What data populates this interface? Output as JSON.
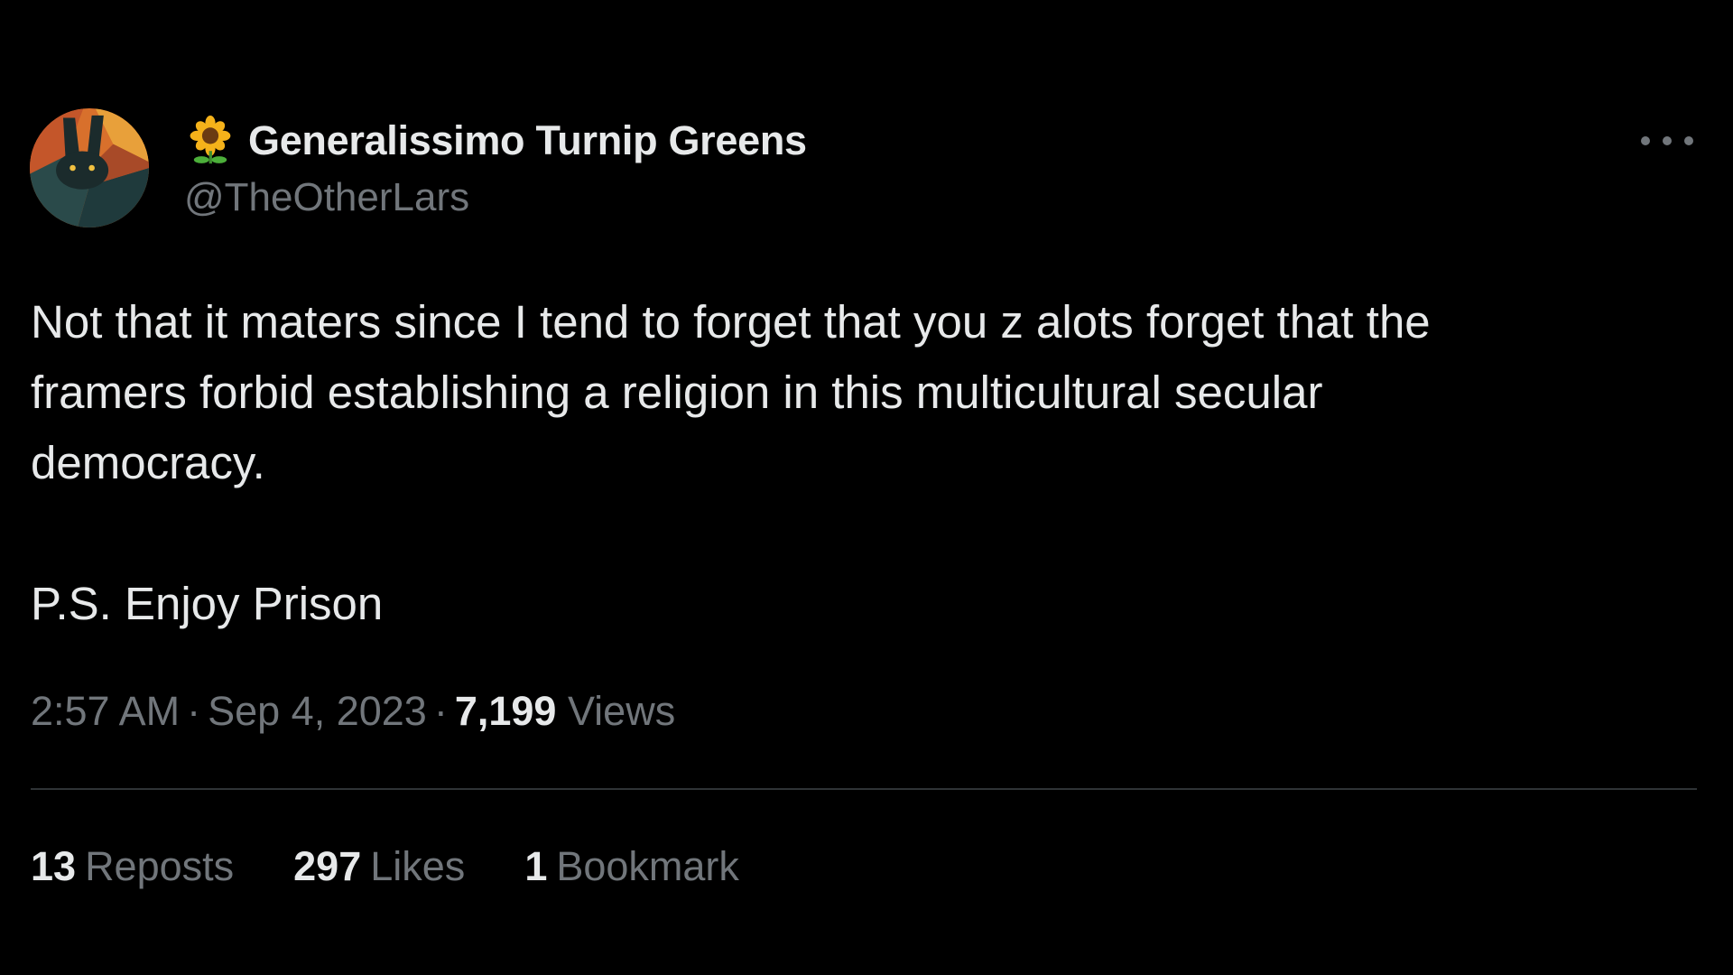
{
  "author": {
    "display_name": "Generalissimo Turnip Greens",
    "handle": "@TheOtherLars",
    "name_emoji": "sunflower-icon"
  },
  "tweet": {
    "lines": [
      "Not that it maters since I tend to forget that you z  alots forget that the",
      "framers forbid establishing a religion in this multicultural secular",
      "democracy."
    ],
    "ps": "P.S. Enjoy Prison"
  },
  "meta": {
    "time": "2:57 AM",
    "date": "Sep 4, 2023",
    "views_count": "7,199",
    "views_label": "Views",
    "separator": "·"
  },
  "stats": {
    "reposts_count": "13",
    "reposts_label": "Reposts",
    "likes_count": "297",
    "likes_label": "Likes",
    "bookmarks_count": "1",
    "bookmarks_label": "Bookmark"
  },
  "colors": {
    "background": "#000000",
    "text_primary": "#e7e9ea",
    "text_secondary": "#71767b",
    "divider": "#2f3336"
  }
}
